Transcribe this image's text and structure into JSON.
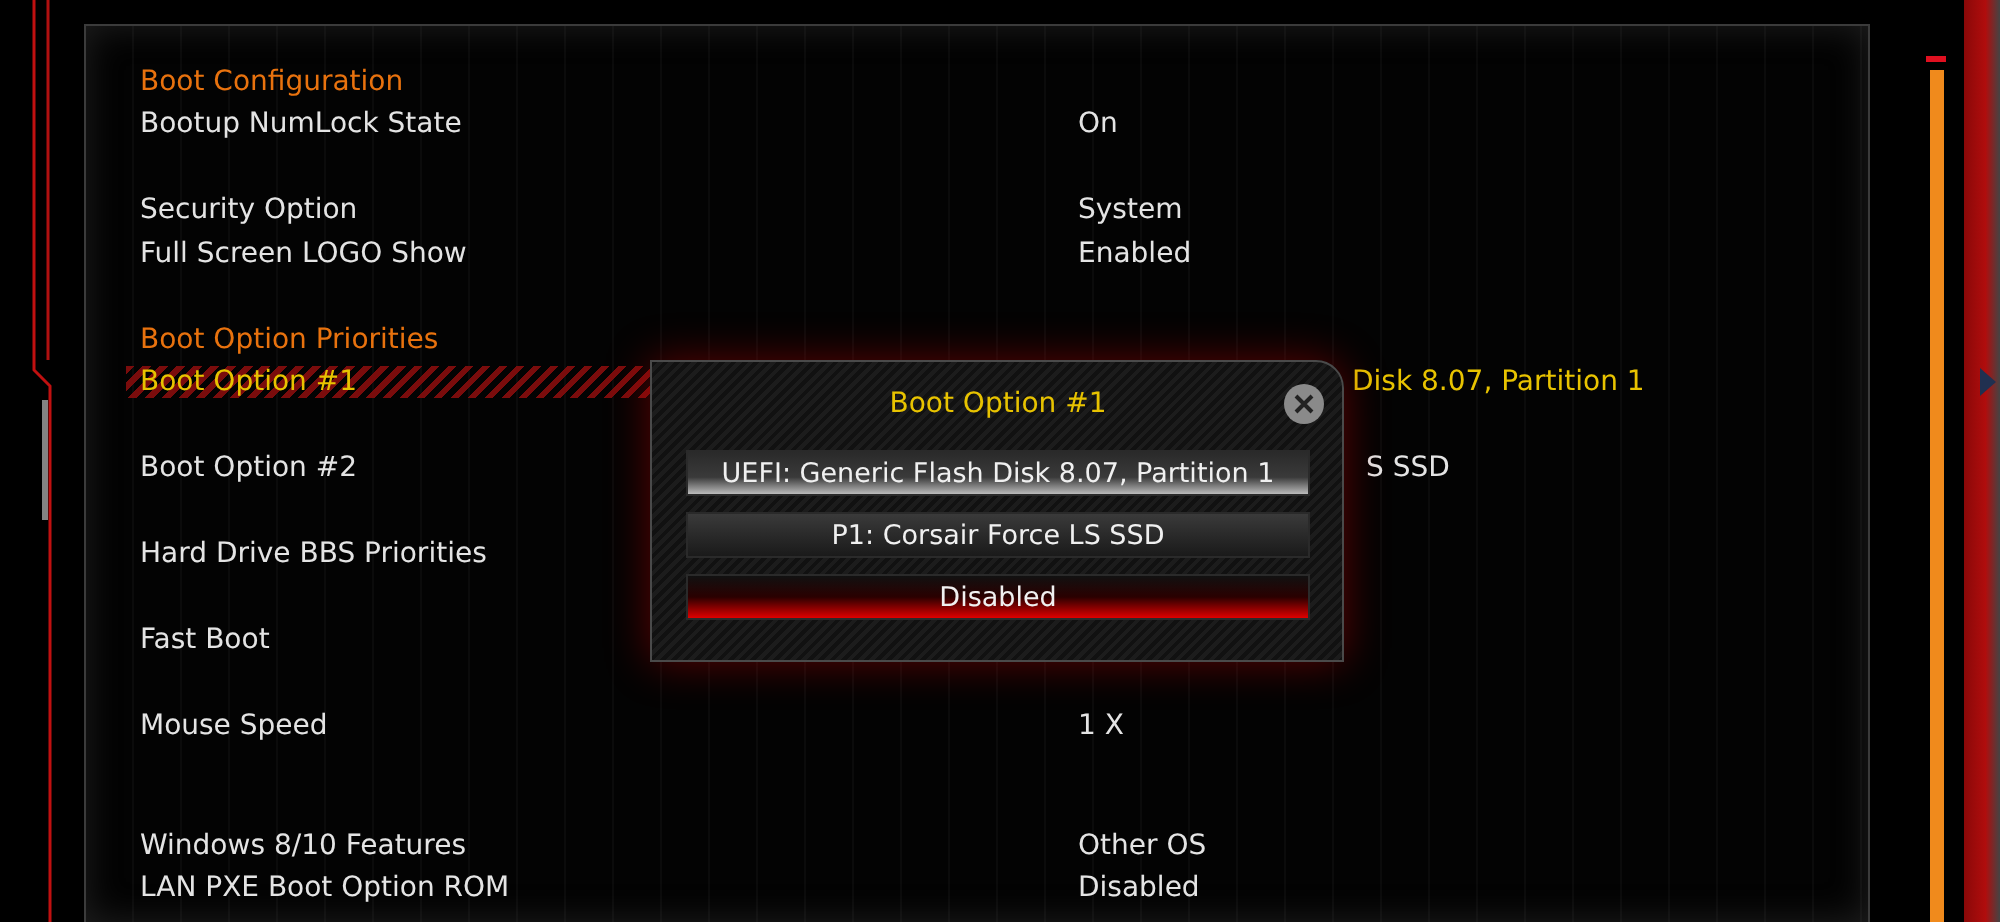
{
  "groups": [
    {
      "rows": [
        {
          "kind": "header",
          "label": "Boot Configuration"
        },
        {
          "kind": "setting",
          "label": "Bootup NumLock State",
          "value": "On",
          "selected": false
        }
      ]
    },
    {
      "rows": [
        {
          "kind": "setting",
          "label": "Security Option",
          "value": "System",
          "selected": false
        },
        {
          "kind": "setting",
          "label": "Full Screen LOGO Show",
          "value": "Enabled",
          "selected": false
        }
      ]
    },
    {
      "rows": [
        {
          "kind": "header",
          "label": "Boot Option Priorities"
        },
        {
          "kind": "setting",
          "label": "Boot Option #1",
          "value": "Disk 8.07, Partition 1",
          "selected": true,
          "partial": true
        }
      ]
    },
    {
      "rows": [
        {
          "kind": "setting",
          "label": "Boot Option #2",
          "value": "S SSD",
          "selected": false,
          "partial": true
        }
      ]
    },
    {
      "rows": [
        {
          "kind": "setting",
          "label": "Hard Drive BBS Priorities",
          "selected": false
        }
      ]
    },
    {
      "rows": [
        {
          "kind": "setting",
          "label": "Fast Boot",
          "selected": false
        }
      ]
    },
    {
      "rows": [
        {
          "kind": "setting",
          "label": "Mouse Speed",
          "value": "1 X",
          "selected": false
        }
      ]
    },
    {
      "rows": [
        {
          "kind": "setting",
          "label": "Windows 8/10 Features",
          "value": "Other OS",
          "selected": false
        },
        {
          "kind": "setting",
          "label": "LAN PXE Boot Option ROM",
          "value": "Disabled",
          "selected": false
        }
      ]
    }
  ],
  "dialog": {
    "title": "Boot Option #1",
    "options": [
      {
        "label": "UEFI: Generic Flash Disk 8.07, Partition 1",
        "selected": true,
        "focused": false
      },
      {
        "label": "P1: Corsair Force LS SSD",
        "selected": false,
        "focused": false
      },
      {
        "label": "Disabled",
        "selected": false,
        "focused": true
      }
    ]
  }
}
